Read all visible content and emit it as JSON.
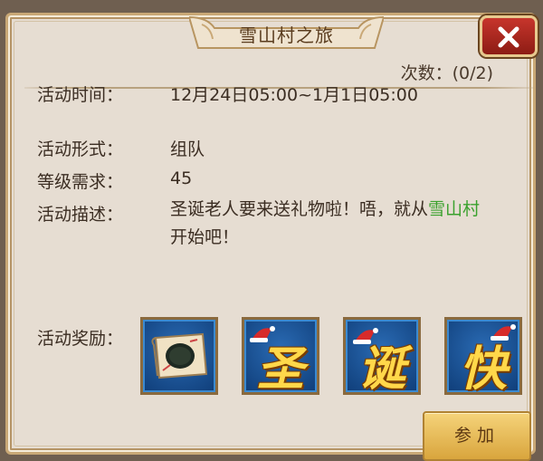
{
  "dialog": {
    "title": "雪山村之旅",
    "count_text": "次数：(0/2)"
  },
  "fields": {
    "time_label": "活动时间：",
    "time_value": "12月24日05:00~1月1日05:00",
    "form_label": "活动形式：",
    "form_value": "组队",
    "level_label": "等级需求：",
    "level_value": "45",
    "desc_label": "活动描述：",
    "desc_part1": "圣诞老人要来送礼物啦！唔，就从",
    "desc_highlight": "雪山村",
    "desc_part2": "开始吧！"
  },
  "rewards": {
    "label": "活动奖励：",
    "items": [
      {
        "icon": "map-scroll-icon"
      },
      {
        "glyph": "圣",
        "icon": "sheng-glyph-icon"
      },
      {
        "glyph": "诞",
        "icon": "dan-glyph-icon"
      },
      {
        "glyph": "快",
        "icon": "kuai-glyph-icon"
      }
    ]
  },
  "buttons": {
    "join_label": "参加"
  },
  "colors": {
    "panel_bg": "#e6ddd2",
    "highlight": "#3aa12d",
    "close_red": "#b8291f",
    "join_gold": "#e9bb55",
    "item_blue": "#1f5aa0"
  }
}
